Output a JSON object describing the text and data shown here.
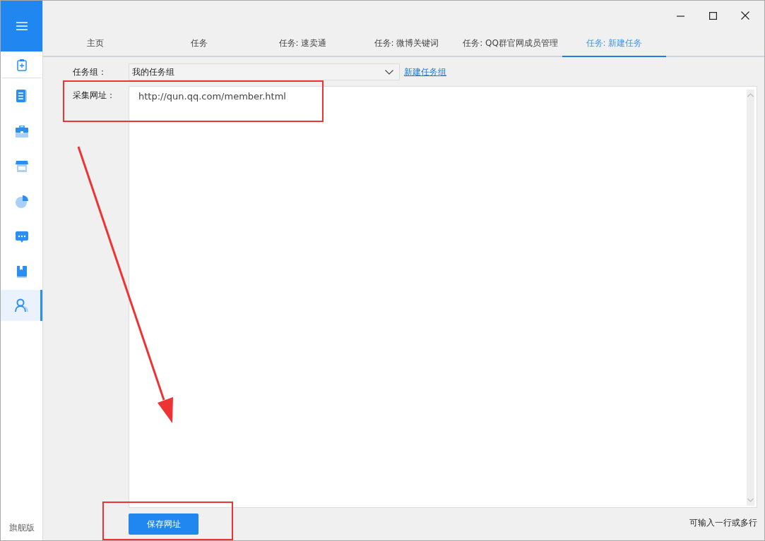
{
  "sidebar": {
    "edition": "旗舰版",
    "items": [
      {
        "selected": false
      },
      {
        "selected": false
      },
      {
        "selected": false
      },
      {
        "selected": false
      },
      {
        "selected": false
      },
      {
        "selected": false
      },
      {
        "selected": false
      },
      {
        "selected": true
      }
    ]
  },
  "tabs": [
    {
      "label": "主页",
      "selected": false
    },
    {
      "label": "任务",
      "selected": false
    },
    {
      "label": "任务: 速卖通",
      "selected": false
    },
    {
      "label": "任务: 微博关键词",
      "selected": false
    },
    {
      "label": "任务: QQ群官网成员管理",
      "selected": false
    },
    {
      "label": "任务: 新建任务",
      "selected": true
    }
  ],
  "form": {
    "group_label": "任务组：",
    "group_value": "我的任务组",
    "new_group_link": "新建任务组",
    "url_label": "采集网址：",
    "url_value": "http://qun.qq.com/member.html",
    "save_button": "保存网址",
    "hint": "可输入一行或多行"
  },
  "annotations": [
    {
      "kind": "box"
    },
    {
      "kind": "arrow"
    },
    {
      "kind": "box"
    }
  ]
}
